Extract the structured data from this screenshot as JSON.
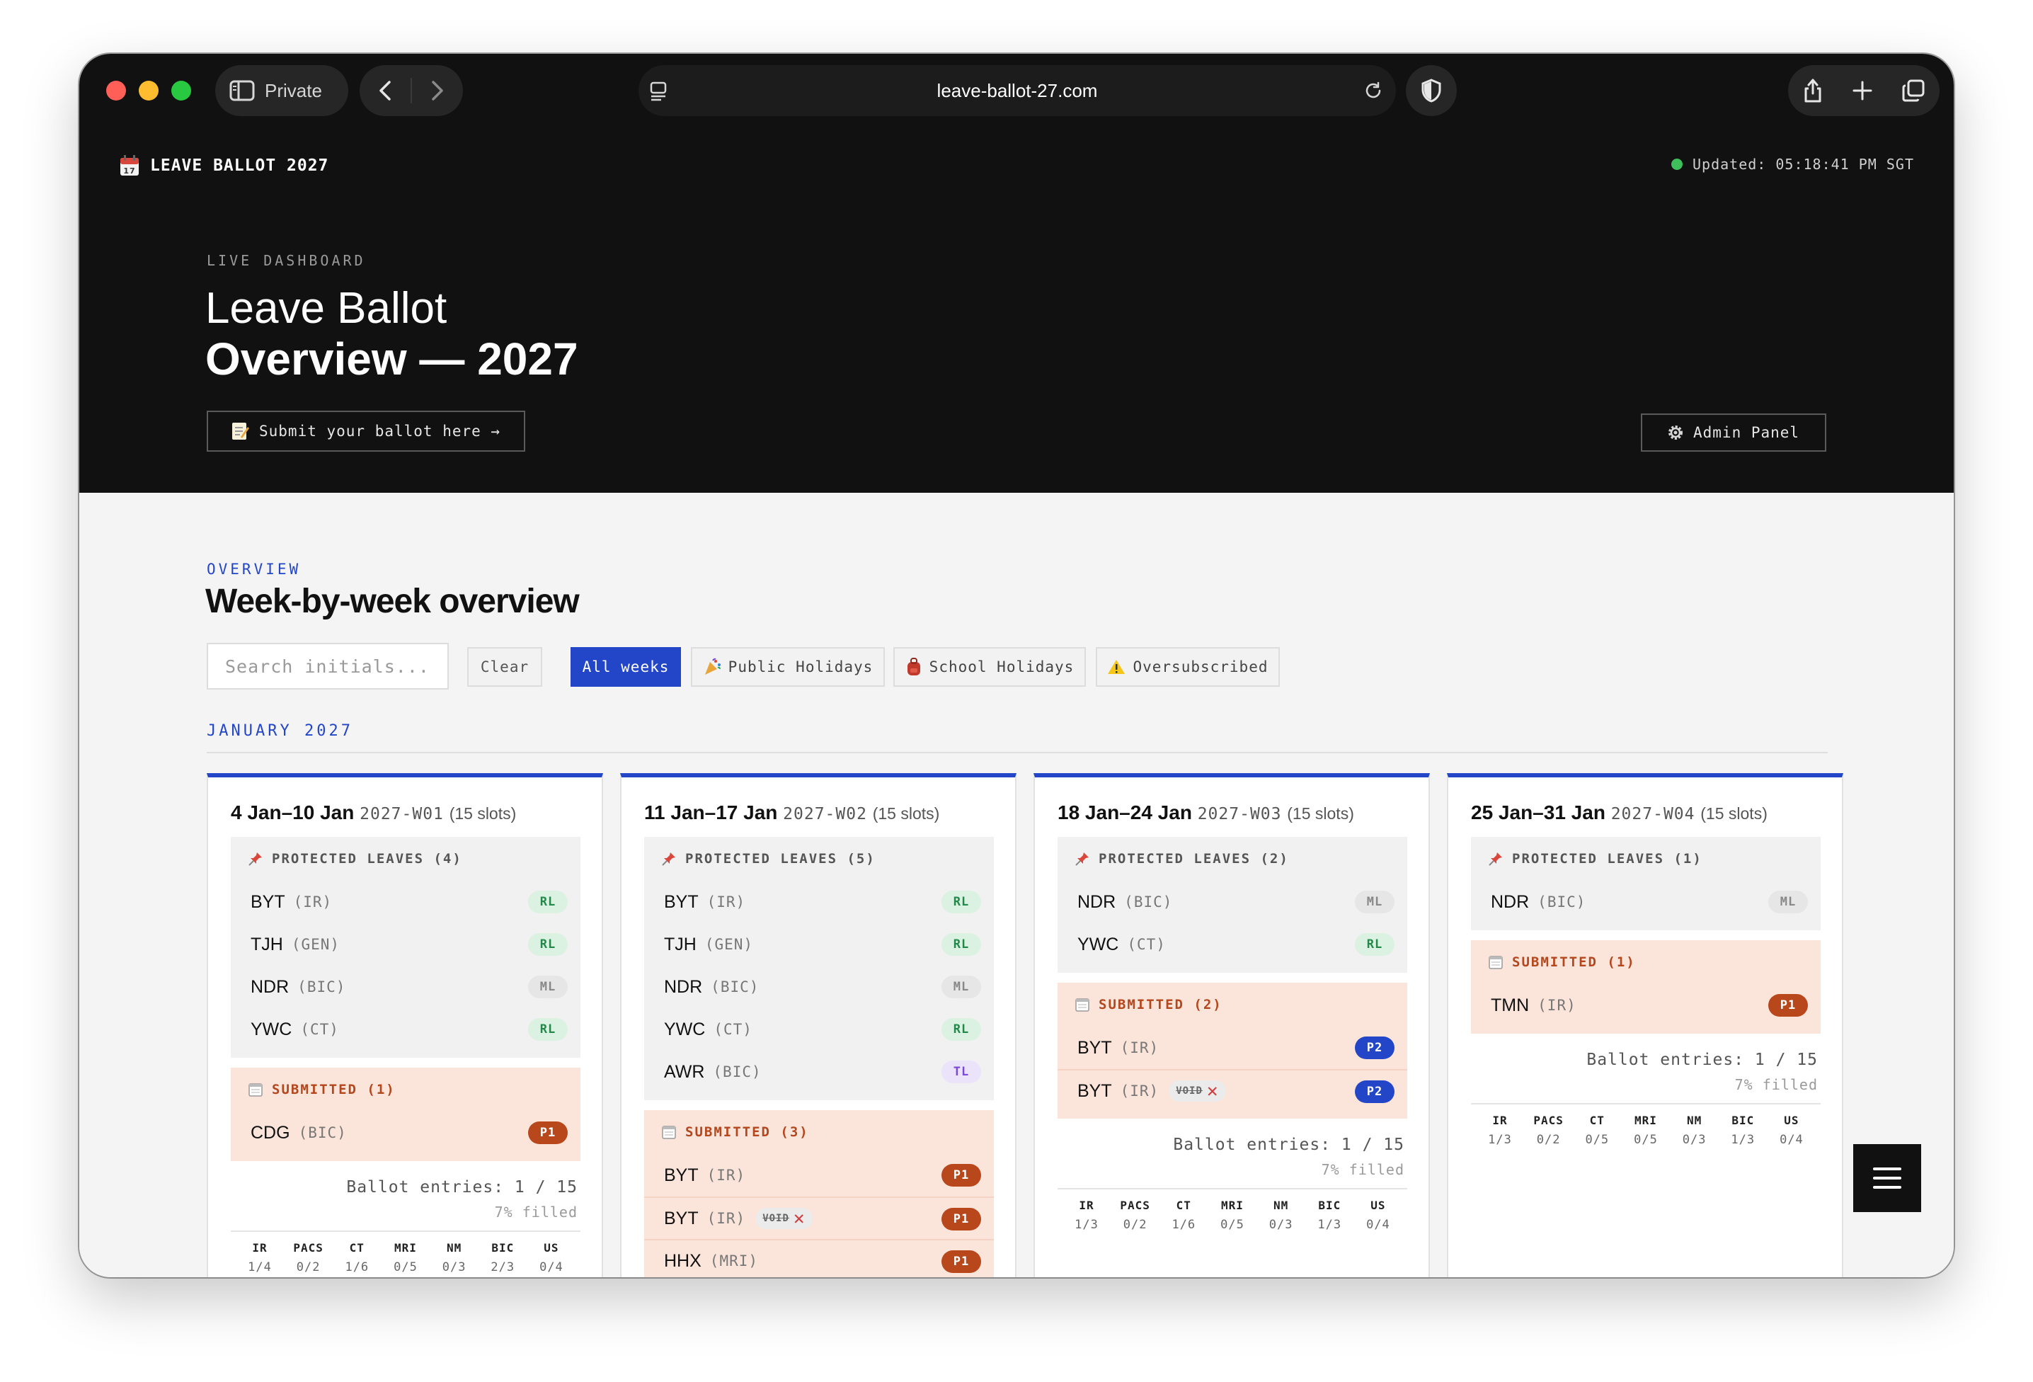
{
  "browser": {
    "private_label": "Private",
    "url": "leave-ballot-27.com"
  },
  "header": {
    "brand": "LEAVE BALLOT 2027",
    "updated": "Updated: 05:18:41 PM SGT",
    "eyebrow": "LIVE DASHBOARD",
    "title_line1": "Leave Ballot",
    "title_line2": "Overview — 2027",
    "submit_label": "Submit your ballot here →",
    "admin_label": "Admin Panel"
  },
  "overview": {
    "eyebrow": "OVERVIEW",
    "title": "Week-by-week overview",
    "search_placeholder": "Search initials...",
    "clear_label": "Clear",
    "filters": [
      "All weeks",
      "Public Holidays",
      "School Holidays",
      "Oversubscribed"
    ],
    "month": "JANUARY 2027"
  },
  "colors": {
    "accent": "#2346c9",
    "p1": "#b9471c",
    "rl": "#23894a",
    "tl": "#7a4ad6"
  },
  "stat_labels": [
    "IR",
    "PACS",
    "CT",
    "MRI",
    "NM",
    "BIC",
    "US"
  ],
  "weeks": [
    {
      "range": "4 Jan–10 Jan",
      "code": "2027-W01",
      "slots": "(15 slots)",
      "protected_title": "PROTECTED LEAVES (4)",
      "protected": [
        {
          "ini": "BYT",
          "dept": "(IR)",
          "badge": "RL"
        },
        {
          "ini": "TJH",
          "dept": "(GEN)",
          "badge": "RL"
        },
        {
          "ini": "NDR",
          "dept": "(BIC)",
          "badge": "ML"
        },
        {
          "ini": "YWC",
          "dept": "(CT)",
          "badge": "RL"
        }
      ],
      "submitted_title": "SUBMITTED (1)",
      "submitted": [
        {
          "ini": "CDG",
          "dept": "(BIC)",
          "badge": "P1",
          "void": false
        }
      ],
      "entries": "Ballot entries: 1 / 15",
      "filled": "7% filled",
      "stats": [
        "1/4",
        "0/2",
        "1/6",
        "0/5",
        "0/3",
        "2/3",
        "0/4"
      ]
    },
    {
      "range": "11 Jan–17 Jan",
      "code": "2027-W02",
      "slots": "(15 slots)",
      "protected_title": "PROTECTED LEAVES (5)",
      "protected": [
        {
          "ini": "BYT",
          "dept": "(IR)",
          "badge": "RL"
        },
        {
          "ini": "TJH",
          "dept": "(GEN)",
          "badge": "RL"
        },
        {
          "ini": "NDR",
          "dept": "(BIC)",
          "badge": "ML"
        },
        {
          "ini": "YWC",
          "dept": "(CT)",
          "badge": "RL"
        },
        {
          "ini": "AWR",
          "dept": "(BIC)",
          "badge": "TL"
        }
      ],
      "submitted_title": "SUBMITTED (3)",
      "submitted": [
        {
          "ini": "BYT",
          "dept": "(IR)",
          "badge": "P1",
          "void": false
        },
        {
          "ini": "BYT",
          "dept": "(IR)",
          "badge": "P1",
          "void": true
        },
        {
          "ini": "HHX",
          "dept": "(MRI)",
          "badge": "P1",
          "void": false
        }
      ],
      "entries": "",
      "filled": "",
      "stats": []
    },
    {
      "range": "18 Jan–24 Jan",
      "code": "2027-W03",
      "slots": "(15 slots)",
      "protected_title": "PROTECTED LEAVES (2)",
      "protected": [
        {
          "ini": "NDR",
          "dept": "(BIC)",
          "badge": "ML"
        },
        {
          "ini": "YWC",
          "dept": "(CT)",
          "badge": "RL"
        }
      ],
      "submitted_title": "SUBMITTED (2)",
      "submitted": [
        {
          "ini": "BYT",
          "dept": "(IR)",
          "badge": "P2",
          "void": false
        },
        {
          "ini": "BYT",
          "dept": "(IR)",
          "badge": "P2",
          "void": true
        }
      ],
      "entries": "Ballot entries: 1 / 15",
      "filled": "7% filled",
      "stats": [
        "1/3",
        "0/2",
        "1/6",
        "0/5",
        "0/3",
        "1/3",
        "0/4"
      ]
    },
    {
      "range": "25 Jan–31 Jan",
      "code": "2027-W04",
      "slots": "(15 slots)",
      "protected_title": "PROTECTED LEAVES (1)",
      "protected": [
        {
          "ini": "NDR",
          "dept": "(BIC)",
          "badge": "ML"
        }
      ],
      "submitted_title": "SUBMITTED (1)",
      "submitted": [
        {
          "ini": "TMN",
          "dept": "(IR)",
          "badge": "P1",
          "void": false
        }
      ],
      "entries": "Ballot entries: 1 / 15",
      "filled": "7% filled",
      "stats": [
        "1/3",
        "0/2",
        "0/5",
        "0/5",
        "0/3",
        "1/3",
        "0/4"
      ]
    }
  ],
  "void_label": "VOID"
}
